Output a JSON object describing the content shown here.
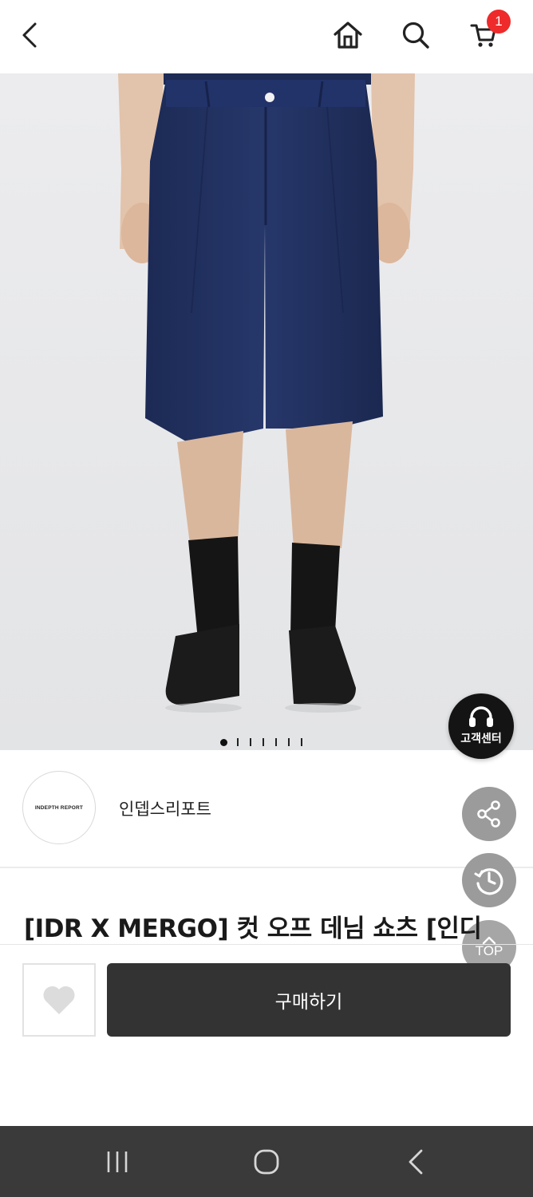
{
  "header": {
    "back_icon": "chevron-left-icon",
    "home_icon": "home-icon",
    "search_icon": "search-icon",
    "cart_icon": "cart-icon",
    "cart_count": "1",
    "cart_badge_color": "#ee2a2a"
  },
  "gallery": {
    "image_count": 7,
    "active_index": 0
  },
  "floating": {
    "customer_center_label": "고객센터",
    "share_icon": "share-icon",
    "history_icon": "history-icon",
    "top_label": "TOP"
  },
  "brand": {
    "logo_text": "INDEPTH REPORT",
    "name": "인뎁스리포트"
  },
  "product": {
    "title": "[IDR X MERGO] 컷 오프 데님 쇼츠 [인디"
  },
  "actions": {
    "wish_icon": "heart-icon",
    "buy_label": "구매하기",
    "buy_color": "#333333"
  },
  "system_nav": {
    "recents_icon": "recents-icon",
    "home_icon": "circle-home-icon",
    "back_icon": "back-icon"
  }
}
